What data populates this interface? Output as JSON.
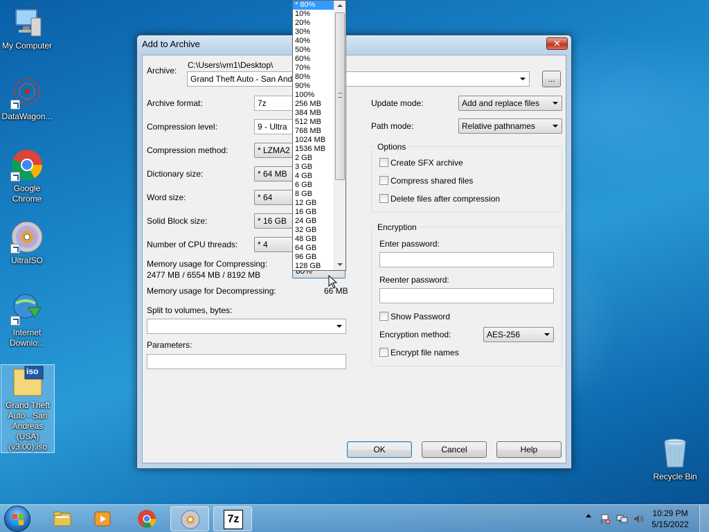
{
  "desktop": {
    "icons": [
      {
        "label": "My Computer"
      },
      {
        "label": "DataWagon..."
      },
      {
        "label": "Google Chrome"
      },
      {
        "label": "UltraISO"
      },
      {
        "label": "Internet Downlo..."
      },
      {
        "label": "Grand Theft Auto - San Andreas (USA) (v3.00).iso"
      },
      {
        "label": "Recycle Bin"
      }
    ],
    "iso_badge": "iso"
  },
  "dialog": {
    "title": "Add to Archive",
    "close_glyph": "✕",
    "archive_label": "Archive:",
    "archive_path": "C:\\Users\\vm1\\Desktop\\",
    "archive_name": "Grand Theft Auto - San Andreas",
    "browse_label": "...",
    "archive_format_label": "Archive format:",
    "archive_format_value": "7z",
    "compression_level_label": "Compression level:",
    "compression_level_value": "9 - Ultra",
    "compression_method_label": "Compression method:",
    "compression_method_value": "* LZMA2",
    "dictionary_size_label": "Dictionary size:",
    "dictionary_size_value": "* 64 MB",
    "word_size_label": "Word size:",
    "word_size_value": "* 64",
    "solid_block_label": "Solid Block size:",
    "solid_block_value": "* 16 GB",
    "cpu_threads_label": "Number of CPU threads:",
    "cpu_threads_value": "* 4",
    "mem_compress_label": "Memory usage for Compressing:",
    "mem_compress_value": "2477 MB / 6554 MB / 8192 MB",
    "mem_combo_partial": "80%",
    "mem_decompress_label": "Memory usage for Decompressing:",
    "mem_decompress_value": "66 MB",
    "split_label": "Split to volumes, bytes:",
    "params_label": "Parameters:",
    "update_mode_label": "Update mode:",
    "update_mode_value": "Add and replace files",
    "path_mode_label": "Path mode:",
    "path_mode_value": "Relative pathnames",
    "options_title": "Options",
    "opt_sfx": "Create SFX archive",
    "opt_shared": "Compress shared files",
    "opt_delete": "Delete files after compression",
    "encryption_title": "Encryption",
    "enter_password_label": "Enter password:",
    "reenter_password_label": "Reenter password:",
    "show_password": "Show Password",
    "encryption_method_label": "Encryption method:",
    "encryption_method_value": "AES-256",
    "encrypt_names": "Encrypt file names",
    "ok_label": "OK",
    "cancel_label": "Cancel",
    "help_label": "Help"
  },
  "dropdown": {
    "selected_index": 0,
    "items": [
      "* 80%",
      "10%",
      "20%",
      "30%",
      "40%",
      "50%",
      "60%",
      "70%",
      "80%",
      "90%",
      "100%",
      "256 MB",
      "384 MB",
      "512 MB",
      "768 MB",
      "1024 MB",
      "1536 MB",
      "2 GB",
      "3 GB",
      "4 GB",
      "6 GB",
      "8 GB",
      "12 GB",
      "16 GB",
      "24 GB",
      "32 GB",
      "48 GB",
      "64 GB",
      "96 GB",
      "128 GB"
    ]
  },
  "taskbar": {
    "time": "10:29 PM",
    "date": "5/15/2022",
    "sevenzip_label": "7z"
  },
  "colors": {
    "selection": "#3399ff",
    "dialog_frame": "#bcd3ea"
  }
}
